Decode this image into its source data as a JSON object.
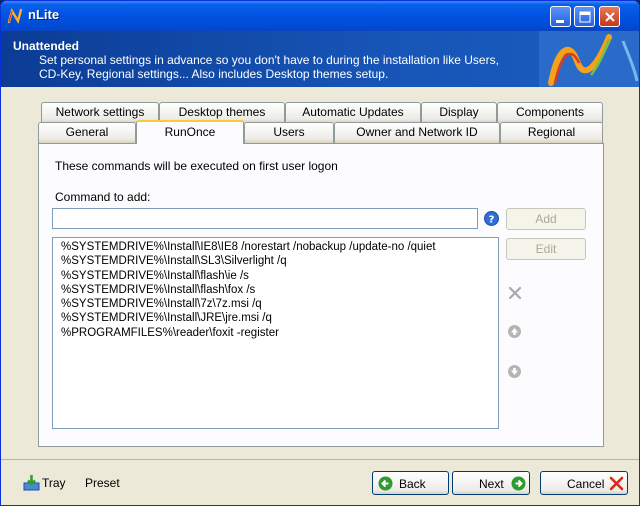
{
  "window": {
    "title": "nLite"
  },
  "banner": {
    "title": "Unattended",
    "description": "Set personal settings in advance so you don't have to during the installation like Users, CD-Key, Regional settings... Also includes Desktop themes setup."
  },
  "tabs_row1": [
    "Network settings",
    "Desktop themes",
    "Automatic Updates",
    "Display",
    "Components"
  ],
  "tabs_row2": [
    "General",
    "RunOnce",
    "Users",
    "Owner and Network ID",
    "Regional"
  ],
  "active_tab": "RunOnce",
  "runonce": {
    "intro": "These commands will be executed on first user logon",
    "command_label": "Command to add:",
    "command_value": "",
    "add_label": "Add",
    "edit_label": "Edit",
    "commands": [
      "%SYSTEMDRIVE%\\Install\\IE8\\IE8 /norestart /nobackup /update-no /quiet",
      "%SYSTEMDRIVE%\\Install\\SL3\\Silverlight /q",
      "%SYSTEMDRIVE%\\Install\\flash\\ie /s",
      "%SYSTEMDRIVE%\\Install\\flash\\fox /s",
      "%SYSTEMDRIVE%\\Install\\7z\\7z.msi /q",
      "%SYSTEMDRIVE%\\Install\\JRE\\jre.msi /q",
      "%PROGRAMFILES%\\reader\\foxit -register"
    ]
  },
  "footer": {
    "tray_label": "Tray",
    "preset_label": "Preset",
    "back_label": "Back",
    "next_label": "Next",
    "cancel_label": "Cancel"
  },
  "colors": {
    "titlebar": "#0053e1",
    "banner": "#1653b4",
    "active_tab_accent": "#ffc83c"
  }
}
